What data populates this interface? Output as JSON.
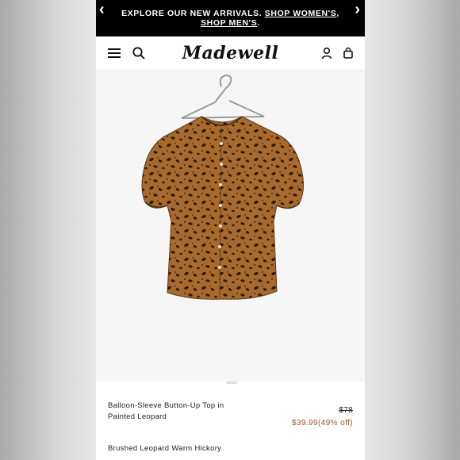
{
  "promo": {
    "text": "EXPLORE OUR NEW ARRIVALS.",
    "link_women": "SHOP WOMEN'S",
    "separator": ",",
    "link_men": "SHOP MEN'S",
    "end": ".",
    "prev_arrow": "‹",
    "next_arrow": "›"
  },
  "header": {
    "logo": "Madewell"
  },
  "product": {
    "title": "Balloon-Sleeve Button-Up Top in Painted Leopard",
    "price_original": "$78",
    "price_sale": "$39.99(49% off)",
    "color": "Brushed Leopard Warm Hickory"
  },
  "colors": {
    "sale": "#a0522d",
    "promo_bg": "#000000"
  },
  "icons": [
    "menu-icon",
    "search-icon",
    "account-icon",
    "bag-icon",
    "chevron-left-icon",
    "chevron-right-icon"
  ]
}
